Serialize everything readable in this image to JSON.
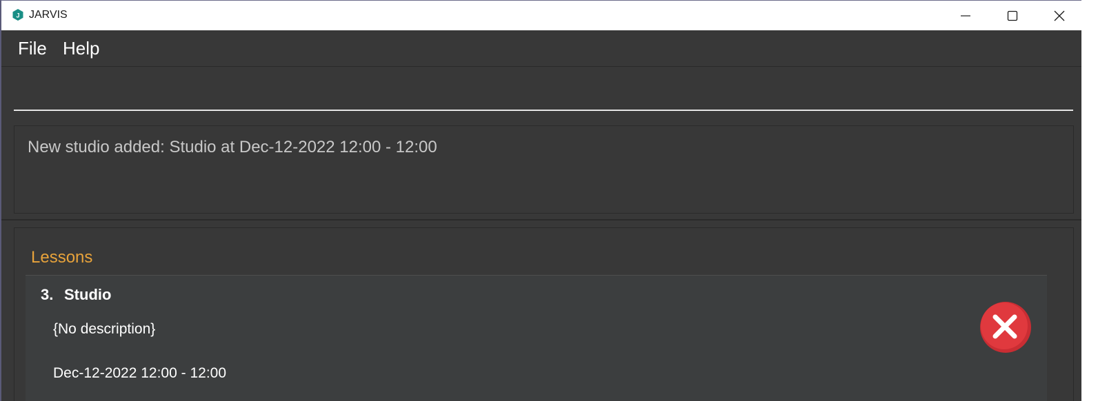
{
  "window": {
    "title": "JARVIS",
    "app_icon": "jarvis-logo-icon",
    "controls": {
      "minimize": "minimize-icon",
      "maximize": "maximize-icon",
      "close": "close-icon"
    }
  },
  "menubar": {
    "items": [
      {
        "label": "File"
      },
      {
        "label": "Help"
      }
    ]
  },
  "command": {
    "value": "",
    "placeholder": ""
  },
  "result": {
    "message": "New studio added: Studio at Dec-12-2022 12:00 - 12:00"
  },
  "lessons": {
    "header": "Lessons",
    "items": [
      {
        "index": "3.",
        "name": "Studio",
        "description": "{No description}",
        "time": "Dec-12-2022 12:00 - 12:00",
        "status_icon": "incomplete-x-icon"
      }
    ]
  },
  "colors": {
    "background": "#383838",
    "accent": "#e8a33b",
    "status_incomplete": "#e0393e",
    "app_icon": "#1a8f86"
  }
}
